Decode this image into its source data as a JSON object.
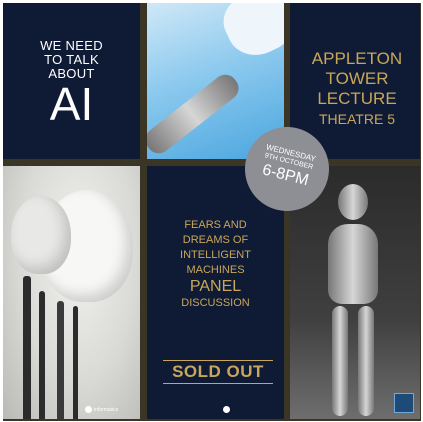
{
  "tile1": {
    "headline": "WE NEED TO TALK ABOUT",
    "ai": "AI"
  },
  "tile3": {
    "line1": "APPLETON",
    "line2": "TOWER",
    "line3": "LECTURE",
    "line4": "THEATRE 5"
  },
  "badge": {
    "day": "WEDNESDAY",
    "date": "9TH OCTOBER",
    "time": "6-8PM"
  },
  "tile5": {
    "line1": "FEARS AND",
    "line2": "DREAMS OF",
    "line3": "INTELLIGENT",
    "line4": "MACHINES",
    "line5": "PANEL",
    "line6": "DISCUSSION",
    "sold_out": "SOLD OUT"
  },
  "logos": {
    "informatics": "informatics"
  },
  "colors": {
    "navy": "#0f1a35",
    "gold": "#c9a75a",
    "badge": "#8d8f94"
  }
}
